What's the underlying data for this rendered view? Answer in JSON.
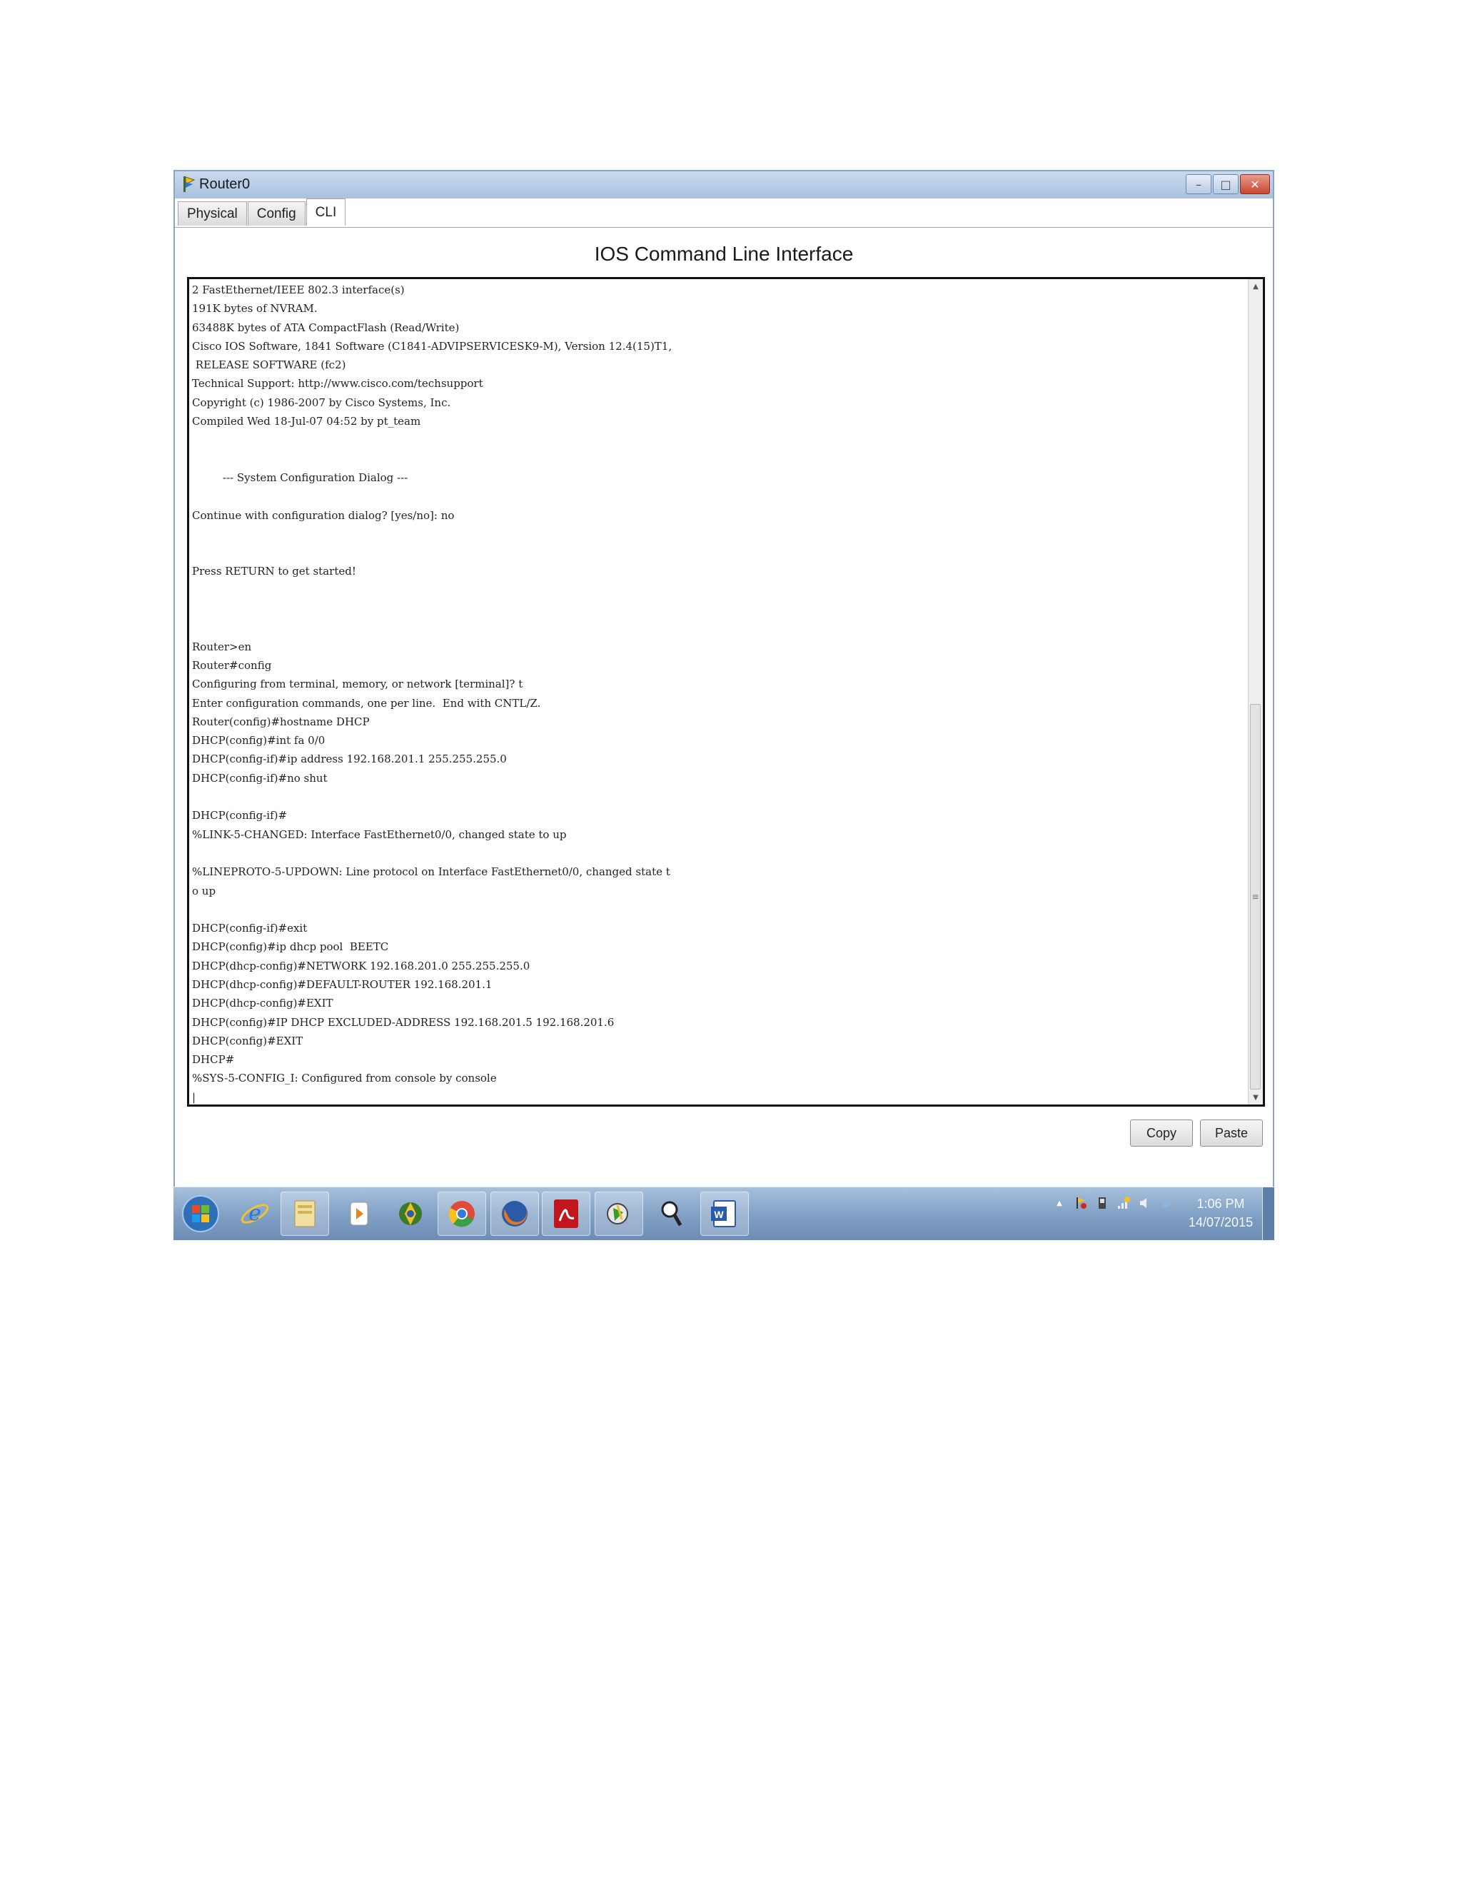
{
  "window": {
    "title": "Router0",
    "controls": {
      "minimize": "–",
      "maximize": "□",
      "close": "✕"
    }
  },
  "tabs": [
    {
      "label": "Physical",
      "active": false
    },
    {
      "label": "Config",
      "active": false
    },
    {
      "label": "CLI",
      "active": true
    }
  ],
  "cli": {
    "title": "IOS Command Line Interface",
    "output": "2 FastEthernet/IEEE 802.3 interface(s)\n191K bytes of NVRAM.\n63488K bytes of ATA CompactFlash (Read/Write)\nCisco IOS Software, 1841 Software (C1841-ADVIPSERVICESK9-M), Version 12.4(15)T1,\n RELEASE SOFTWARE (fc2)\nTechnical Support: http://www.cisco.com/techsupport\nCopyright (c) 1986-2007 by Cisco Systems, Inc.\nCompiled Wed 18-Jul-07 04:52 by pt_team\n\n\n         --- System Configuration Dialog ---\n\nContinue with configuration dialog? [yes/no]: no\n\n\nPress RETURN to get started!\n\n\n\nRouter>en\nRouter#config\nConfiguring from terminal, memory, or network [terminal]? t\nEnter configuration commands, one per line.  End with CNTL/Z.\nRouter(config)#hostname DHCP\nDHCP(config)#int fa 0/0\nDHCP(config-if)#ip address 192.168.201.1 255.255.255.0\nDHCP(config-if)#no shut\n\nDHCP(config-if)#\n%LINK-5-CHANGED: Interface FastEthernet0/0, changed state to up\n\n%LINEPROTO-5-UPDOWN: Line protocol on Interface FastEthernet0/0, changed state t\no up\n\nDHCP(config-if)#exit\nDHCP(config)#ip dhcp pool  BEETC\nDHCP(dhcp-config)#NETWORK 192.168.201.0 255.255.255.0\nDHCP(dhcp-config)#DEFAULT-ROUTER 192.168.201.1\nDHCP(dhcp-config)#EXIT\nDHCP(config)#IP DHCP EXCLUDED-ADDRESS 192.168.201.5 192.168.201.6\nDHCP(config)#EXIT\nDHCP#\n%SYS-5-CONFIG_I: Configured from console by console\n|",
    "copy_label": "Copy",
    "paste_label": "Paste"
  },
  "scrollbar": {
    "up": "▲",
    "down": "▼",
    "grip": "≡"
  },
  "taskbar": {
    "apps": [
      {
        "name": "start-orb"
      },
      {
        "name": "internet-explorer"
      },
      {
        "name": "file-explorer"
      },
      {
        "name": "media-player"
      },
      {
        "name": "network-app"
      },
      {
        "name": "chrome"
      },
      {
        "name": "firefox"
      },
      {
        "name": "acrobat"
      },
      {
        "name": "packet-tracer"
      },
      {
        "name": "search-tool"
      },
      {
        "name": "word"
      }
    ],
    "tray_arrow": "▲",
    "time": "1:06 PM",
    "date": "14/07/2015"
  }
}
